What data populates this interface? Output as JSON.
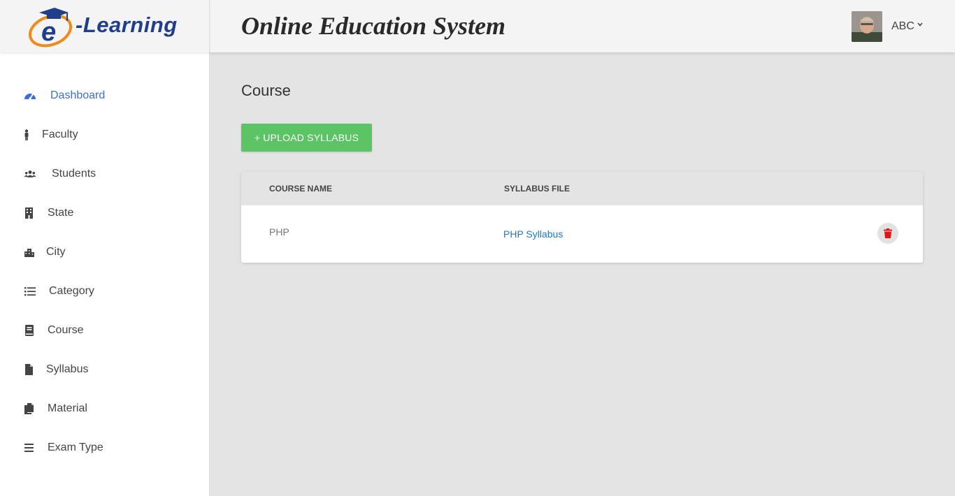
{
  "brand": {
    "logo_text": "-Learning",
    "logo_letter": "e"
  },
  "header": {
    "title": "Online Education System",
    "user_name": "ABC"
  },
  "sidebar": {
    "items": [
      {
        "label": "Dashboard",
        "icon": "dashboard-icon",
        "active": true
      },
      {
        "label": "Faculty",
        "icon": "person-icon"
      },
      {
        "label": "Students",
        "icon": "users-icon"
      },
      {
        "label": "State",
        "icon": "building-icon"
      },
      {
        "label": "City",
        "icon": "city-icon"
      },
      {
        "label": "Category",
        "icon": "list-icon"
      },
      {
        "label": "Course",
        "icon": "book-icon"
      },
      {
        "label": "Syllabus",
        "icon": "file-icon"
      },
      {
        "label": "Material",
        "icon": "copy-icon"
      },
      {
        "label": "Exam Type",
        "icon": "menu-icon"
      }
    ]
  },
  "main": {
    "heading": "Course",
    "upload_button": "+ UPLOAD SYLLABUS",
    "table": {
      "columns": [
        "COURSE NAME",
        "SYLLABUS FILE"
      ],
      "rows": [
        {
          "course_name": "PHP",
          "syllabus_file": "PHP Syllabus"
        }
      ]
    }
  },
  "colors": {
    "accent_active": "#3b6fd6",
    "upload_button": "#5cc465",
    "link": "#1f78d1",
    "delete_icon": "#e81212"
  }
}
